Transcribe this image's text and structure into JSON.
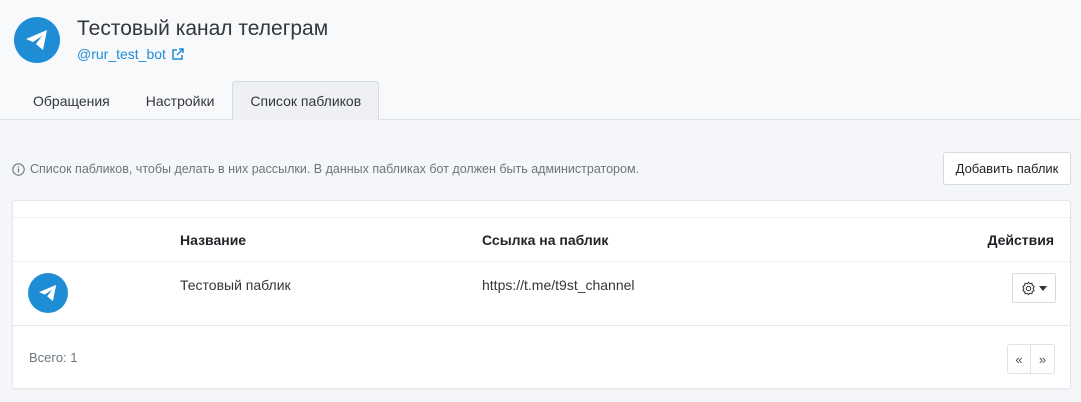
{
  "channel": {
    "title": "Тестовый канал телеграм",
    "bot_link": "@rur_test_bot",
    "logo_icon": "telegram-icon",
    "accent_color": "#1f8dd6"
  },
  "tabs": [
    {
      "label": "Обращения",
      "active": false
    },
    {
      "label": "Настройки",
      "active": false
    },
    {
      "label": "Список пабликов",
      "active": true
    }
  ],
  "info_text": "Список пабликов, чтобы делать в них рассылки. В данных пабликах бот должен быть администратором.",
  "add_button_label": "Добавить паблик",
  "table": {
    "columns": [
      "Название",
      "Ссылка на паблик",
      "Действия"
    ],
    "rows": [
      {
        "avatar_icon": "telegram-icon",
        "name": "Тестовый паблик",
        "link": "https://t.me/t9st_channel",
        "action_icon": "gear-icon"
      }
    ]
  },
  "footer": {
    "total": "Всего: 1",
    "prev": "«",
    "next": "»"
  }
}
